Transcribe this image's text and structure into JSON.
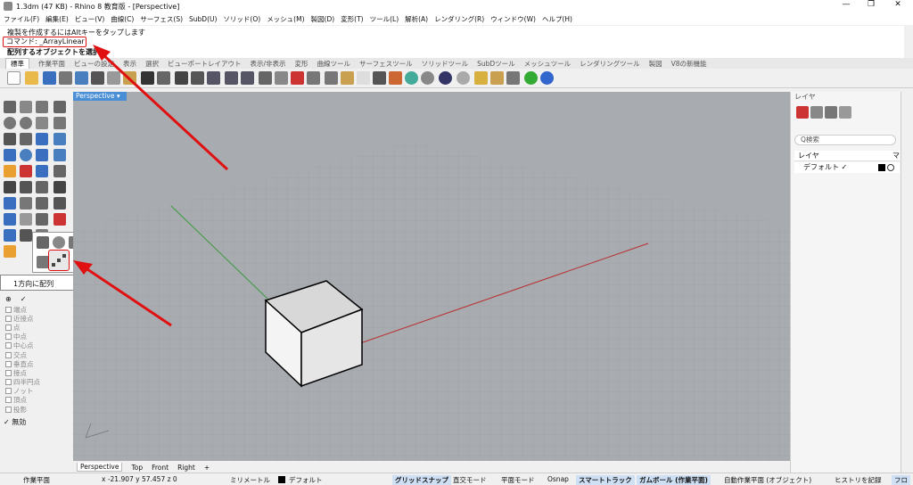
{
  "window": {
    "title": "1.3dm (47 KB) - Rhino 8 教育版 - [Perspective]",
    "minimize": "—",
    "restore": "❐",
    "close": "✕"
  },
  "menu": [
    "ファイル(F)",
    "編集(E)",
    "ビュー(V)",
    "曲線(C)",
    "サーフェス(S)",
    "SubD(U)",
    "ソリッド(O)",
    "メッシュ(M)",
    "製図(D)",
    "変形(T)",
    "ツール(L)",
    "解析(A)",
    "レンダリング(R)",
    "ウィンドウ(W)",
    "ヘルプ(H)"
  ],
  "command": {
    "history": "複製を作成するにはAltキーをタップします",
    "line": "コマンド: _ArrayLinear",
    "prompt": "配列するオブジェクトを選択"
  },
  "tabs": [
    "標準",
    "作業平面",
    "ビューの設定",
    "表示",
    "選択",
    "ビューポートレイアウト",
    "表示/非表示",
    "変形",
    "曲線ツール",
    "サーフェスツール",
    "ソリッドツール",
    "SubDツール",
    "メッシュツール",
    "レンダリングツール",
    "製図",
    "V8の新機能"
  ],
  "tooltip": "1方向に配列",
  "osnap": {
    "tabs": [
      "⊕",
      "✓"
    ],
    "items": [
      "端点",
      "近接点",
      "点",
      "中点",
      "中心点",
      "交点",
      "垂直点",
      "接点",
      "四半円点",
      "ノット",
      "頂点",
      "投影"
    ],
    "disable": "無効"
  },
  "viewport": {
    "label": "Perspective ▾",
    "bottom_tabs": [
      "Perspective",
      "Top",
      "Front",
      "Right",
      "+"
    ]
  },
  "layers": {
    "title": "レイヤ",
    "search": "Q検索",
    "col_name": "レイヤ",
    "col_m": "マ",
    "default_layer": "デフォルト",
    "check": "✓"
  },
  "status": {
    "cplane": "作業平面",
    "coords": "x -21.907 y 57.457 z 0",
    "unit": "ミリメートル",
    "layer": "デフォルト",
    "grid": "グリッドスナップ",
    "ortho": "直交モード",
    "planar": "平面モード",
    "osnap": "Osnap",
    "smarttrack": "スマートトラック",
    "gumball": "ガムボール (作業平面)",
    "autocplane": "自動作業平面 (オブジェクト)",
    "history": "ヒストリを記録",
    "filter": "フロ"
  }
}
